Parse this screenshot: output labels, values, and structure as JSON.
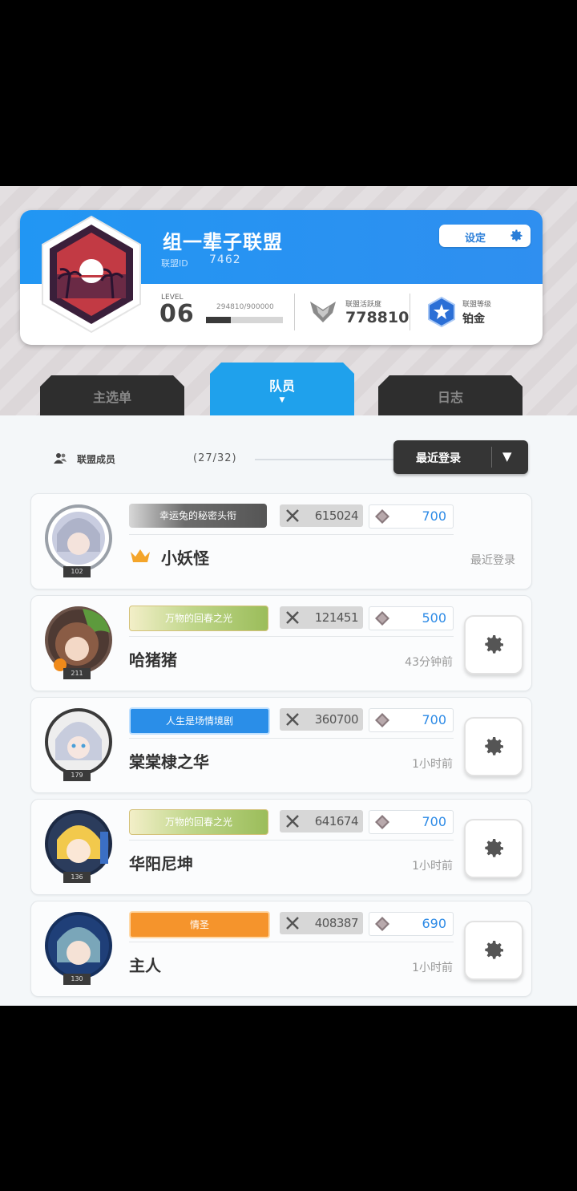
{
  "alliance": {
    "name": "组一辈子联盟",
    "id_label": "联盟ID",
    "id": "7462",
    "settings_label": "设定",
    "level_label": "LEVEL",
    "level": "06",
    "exp_text": "294810/900000",
    "exp_progress": 0.3276,
    "activity_label": "联盟活跃度",
    "activity_value": "778810",
    "rank_label": "联盟等级",
    "rank_value": "铂金"
  },
  "tabs": [
    {
      "label": "主选单"
    },
    {
      "label": "队员",
      "active": true
    },
    {
      "label": "日志"
    }
  ],
  "members_header": {
    "label": "联盟成员",
    "count": "(27/32)",
    "sort_label": "最近登录"
  },
  "members": [
    {
      "name": "小妖怪",
      "level": "102",
      "title": "幸运兔的秘密头衔",
      "power": "615024",
      "contribution": "700",
      "last_login": "最近登录",
      "leader": true
    },
    {
      "name": "哈猪猪",
      "level": "211",
      "title": "万物的回春之光",
      "power": "121451",
      "contribution": "500",
      "last_login": "43分钟前"
    },
    {
      "name": "棠棠棣之华",
      "level": "179",
      "title": "人生是场情境剧",
      "power": "360700",
      "contribution": "700",
      "last_login": "1小时前"
    },
    {
      "name": "华阳尼坤",
      "level": "136",
      "title": "万物的回春之光",
      "power": "641674",
      "contribution": "700",
      "last_login": "1小时前"
    },
    {
      "name": "主人",
      "level": "130",
      "title": "情圣",
      "power": "408387",
      "contribution": "690",
      "last_login": "1小时前"
    }
  ],
  "colors": {
    "accent_blue": "#1fa1ec",
    "header_blue": "#2196f3",
    "dark_tab": "#2e2e2e",
    "contribution_text": "#2c8ae6"
  }
}
